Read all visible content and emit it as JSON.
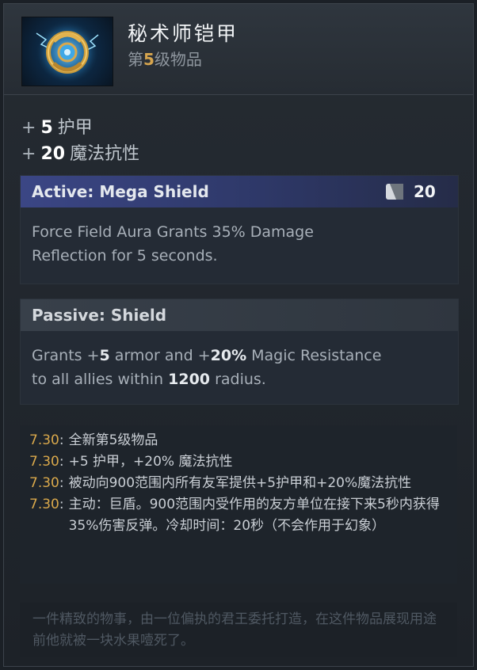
{
  "item": {
    "name": "秘术师铠甲",
    "tier_prefix": "第",
    "tier_num": "5",
    "tier_suffix": "级物品",
    "icon": "mystic-armor-icon"
  },
  "stats": [
    {
      "plus": "+",
      "value": "5",
      "label": "护甲"
    },
    {
      "plus": "+",
      "value": "20",
      "label": "魔法抗性"
    }
  ],
  "active": {
    "title": "Active: Mega Shield",
    "cooldown_icon": "cooldown-icon",
    "cooldown": "20",
    "desc_line1": "Force Field Aura Grants 35% Damage",
    "desc_line2": "Reflection for 5 seconds."
  },
  "passive": {
    "title": "Passive: Shield",
    "d1": "Grants +",
    "armor": "5",
    "d2": " armor and +",
    "mr": "20%",
    "d3": " Magic Resistance",
    "d4": "to all allies within ",
    "radius": "1200",
    "d5": " radius."
  },
  "notes": [
    {
      "version": "7.30",
      "text": "全新第5级物品"
    },
    {
      "version": "7.30",
      "text": "+5 护甲，+20% 魔法抗性"
    },
    {
      "version": "7.30",
      "text": "被动向900范围内所有友军提供+5护甲和+20%魔法抗性"
    },
    {
      "version": "7.30",
      "text": "主动：巨盾。900范围内受作用的友方单位在接下来5秒内获得35%伤害反弹。冷却时间：20秒（不会作用于幻象）"
    }
  ],
  "lore": "一件精致的物事，由一位偏执的君王委托打造，在这件物品展现用途前他就被一块水果噎死了。",
  "colors": {
    "accent_gold": "#d9a84b",
    "active_header": "#3b4685",
    "background": "#1d2228"
  }
}
